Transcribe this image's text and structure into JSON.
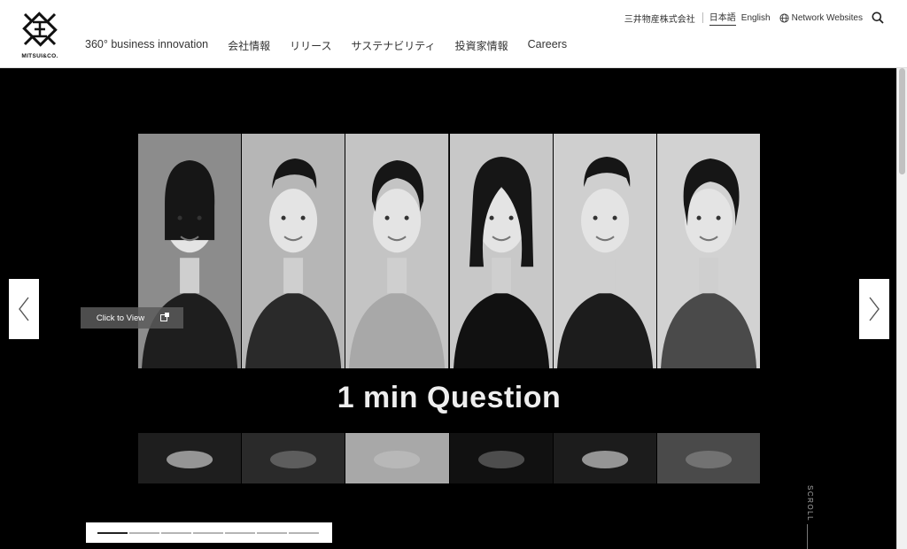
{
  "logo": {
    "text": "MITSUI&CO."
  },
  "nav": [
    {
      "label": "360° business innovation",
      "en": true
    },
    {
      "label": "会社情報"
    },
    {
      "label": "リリース"
    },
    {
      "label": "サステナビリティ"
    },
    {
      "label": "投資家情報"
    },
    {
      "label": "Careers",
      "en": true
    }
  ],
  "utility": {
    "corporate": "三井物産株式会社",
    "lang_ja": "日本語",
    "lang_en": "English",
    "network": "Network Websites",
    "search_icon": "search-icon",
    "globe_icon": "globe-icon"
  },
  "hero": {
    "headline": "1 min Question",
    "cta": "Click to View",
    "portraits": [
      {
        "name": "woman-ponytail",
        "bg": "#8c8c8c",
        "clothes": "#1e1e1e"
      },
      {
        "name": "man-suit-glasses",
        "bg": "#b6b6b6",
        "clothes": "#2a2a2a"
      },
      {
        "name": "woman-bob",
        "bg": "#c4c4c4",
        "clothes": "#a8a8a8"
      },
      {
        "name": "woman-long-hair",
        "bg": "#c8c8c8",
        "clothes": "#111111"
      },
      {
        "name": "man-suit",
        "bg": "#cfcfcf",
        "clothes": "#1c1c1c"
      },
      {
        "name": "woman-short-hair",
        "bg": "#d2d2d2",
        "clothes": "#4a4a4a"
      }
    ],
    "slides_count": 7,
    "active_slide": 0,
    "scroll_label": "SCROLL"
  },
  "colors": {
    "hero_bg": "#000000",
    "text": "#222222"
  }
}
